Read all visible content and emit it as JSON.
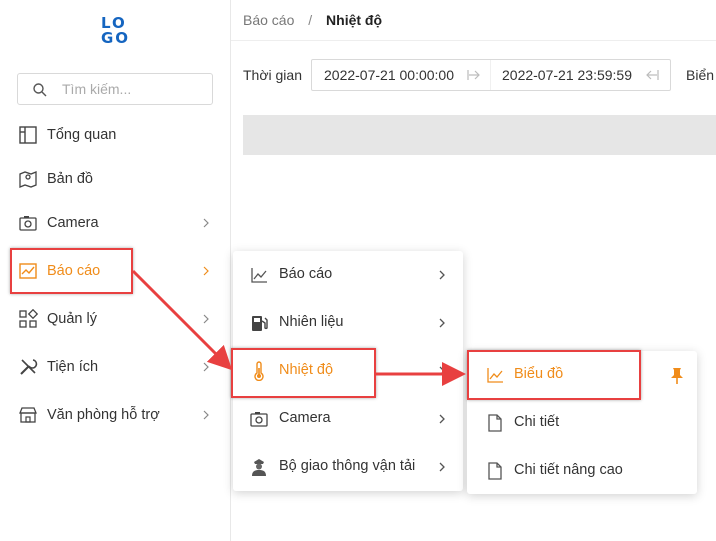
{
  "logo": {
    "line1": "LO",
    "line2": "GO"
  },
  "search": {
    "placeholder": "Tìm kiếm..."
  },
  "sidebar": {
    "items": [
      {
        "label": "Tổng quan",
        "icon": "layout-icon"
      },
      {
        "label": "Bản đồ",
        "icon": "map-icon"
      },
      {
        "label": "Camera",
        "icon": "camera-icon"
      },
      {
        "label": "Báo cáo",
        "icon": "chart-icon",
        "active": true
      },
      {
        "label": "Quản lý",
        "icon": "grid-icon"
      },
      {
        "label": "Tiện ích",
        "icon": "tools-icon"
      },
      {
        "label": "Văn phòng hỗ trợ",
        "icon": "shop-icon"
      }
    ]
  },
  "breadcrumb": {
    "parent": "Báo cáo",
    "separator": "/",
    "current": "Nhiệt độ"
  },
  "filter": {
    "time_label": "Thời gian",
    "start": "2022-07-21 00:00:00",
    "end": "2022-07-21 23:59:59",
    "plate_label": "Biển"
  },
  "submenu1": {
    "items": [
      {
        "label": "Báo cáo",
        "icon": "line-chart-icon"
      },
      {
        "label": "Nhiên liệu",
        "icon": "fuel-icon"
      },
      {
        "label": "Nhiệt độ",
        "icon": "thermometer-icon",
        "active": true
      },
      {
        "label": "Camera",
        "icon": "camera-icon"
      },
      {
        "label": "Bộ giao thông vận tải",
        "icon": "officer-icon"
      }
    ]
  },
  "submenu2": {
    "items": [
      {
        "label": "Biểu đồ",
        "icon": "line-chart-icon",
        "active": true
      },
      {
        "label": "Chi tiết",
        "icon": "file-icon"
      },
      {
        "label": "Chi tiết nâng cao",
        "icon": "file-icon"
      }
    ]
  },
  "colors": {
    "accent": "#f08c1a",
    "highlight": "#e84040",
    "logo": "#1565c0"
  }
}
